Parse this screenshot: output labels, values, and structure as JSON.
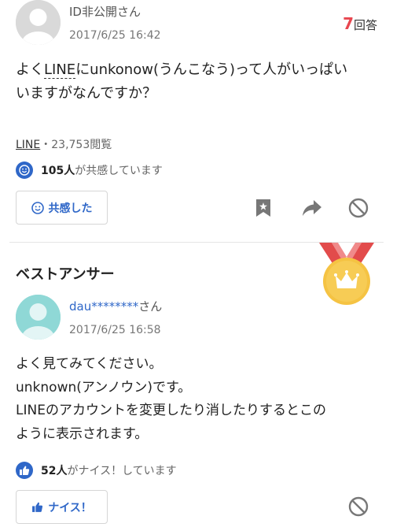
{
  "question": {
    "username": "ID非公開さん",
    "timestamp": "2017/6/25 16:42",
    "answer_count": "7",
    "answer_count_suffix": "回答",
    "body_line1_a": "よく",
    "body_line1_link": "LINE",
    "body_line1_b": "にunkonow(うんこなう)って人がいっぱい",
    "body_line2": "いますがなんですか？",
    "category": "LINE",
    "views": "・23,753閲覧",
    "empathy_count": "105人",
    "empathy_suffix": "が共感しています",
    "empathy_button": "共感した"
  },
  "best_answer": {
    "heading": "ベストアンサー",
    "username": "dau********",
    "username_suffix": "さん",
    "timestamp": "2017/6/25 16:58",
    "body_line1": "よく見てみてください。",
    "body_line2": "unknown(アンノウン)です。",
    "body_line3": "LINEのアカウントを変更したり消したりするとこの",
    "body_line4": "ように表示されます。",
    "nice_count": "52人",
    "nice_suffix": "がナイス！しています",
    "nice_button": "ナイス！"
  },
  "colors": {
    "accent_blue": "#2f67c8",
    "answer_count_red": "#e8464f",
    "medal_gold": "#f5c343",
    "ribbon_red": "#e24b4b"
  },
  "icons": [
    "smile-icon",
    "bookmark-icon",
    "share-icon",
    "block-icon",
    "thumbs-up-icon",
    "medal-icon"
  ]
}
